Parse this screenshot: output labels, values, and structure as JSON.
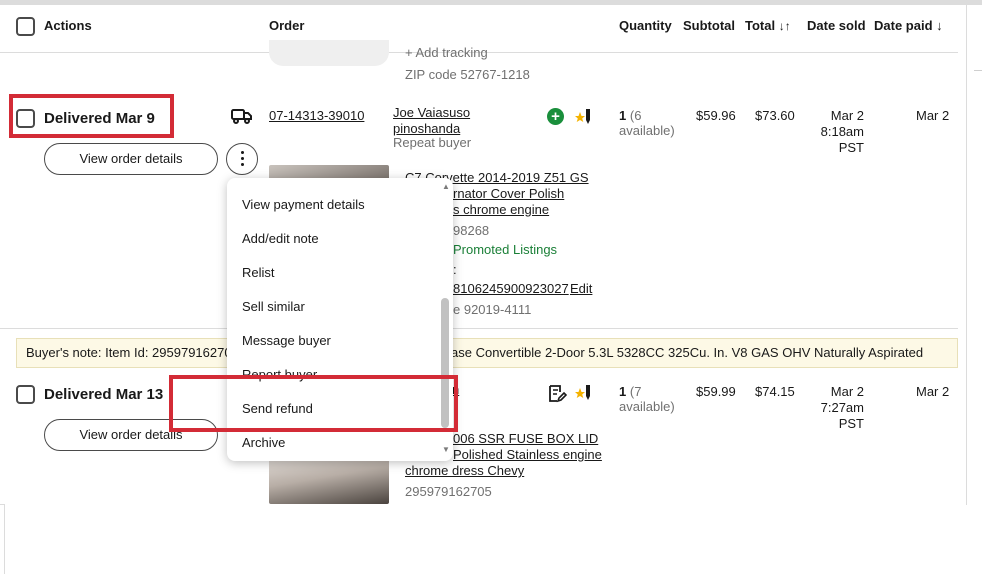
{
  "header": {
    "actions": "Actions",
    "order": "Order",
    "quantity": "Quantity",
    "subtotal": "Subtotal",
    "total": "Total",
    "date_sold": "Date sold",
    "date_paid": "Date paid"
  },
  "prev_row": {
    "add_tracking": "+ Add tracking",
    "zip": "ZIP code 52767-1218"
  },
  "order1": {
    "status": "Delivered Mar 9",
    "view_details": "View order details",
    "order_number": "07-14313-39010",
    "buyer_name": "Joe Vaiasuso",
    "buyer_id": "pinoshanda",
    "buyer_type": "Repeat buyer",
    "qty": "1",
    "qty_available": "(6 available)",
    "subtotal": "$59.96",
    "total": "$73.60",
    "date_sold": "Mar 2",
    "time_sold": "8:18am",
    "tz_sold": "PST",
    "date_paid": "Mar 2",
    "item_title_l1": "C7 Corvette 2014-2019 Z51 GS",
    "item_title_l2": "rnator Cover Polish",
    "item_title_l3": "s chrome engine",
    "item_id_partial": "98268",
    "promoted": "Promoted Listings",
    "tracking_label_partial": ":",
    "tracking_partial": "8106245900923027",
    "edit": "Edit",
    "zip_partial": "e 92019-4111"
  },
  "note": {
    "text": "Buyer's note: Item Id: 295979162708",
    "text_right": "ase Convertible 2-Door 5.3L 5328CC 325Cu. In. V8 GAS OHV Naturally Aspirated"
  },
  "order2": {
    "status": "Delivered Mar 13",
    "view_details": "View order details",
    "qty": "1",
    "qty_available": "(7 available)",
    "subtotal": "$59.99",
    "total": "$74.15",
    "date_sold": "Mar 2",
    "time_sold": "7:27am",
    "tz_sold": "PST",
    "date_paid": "Mar 2",
    "buyer_partial": "n",
    "item_title_l1": "006 SSR FUSE BOX LID",
    "item_title_l2": "Polished Stainless engine",
    "item_title_l3": "chrome dress Chevy",
    "item_id": "295979162705"
  },
  "menu": {
    "items": [
      "View payment details",
      "Add/edit note",
      "Relist",
      "Sell similar",
      "Message buyer",
      "Report buyer",
      "Send refund",
      "Archive"
    ]
  },
  "colors": {
    "highlight": "#d32b36",
    "promoted_green": "#1a7f37",
    "note_bg": "#fdf9e6"
  }
}
